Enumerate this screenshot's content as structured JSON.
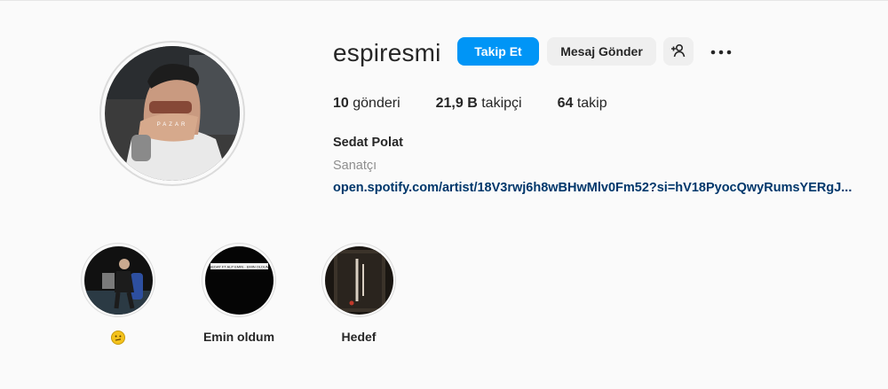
{
  "profile": {
    "username": "espiresmi",
    "full_name": "Sedat Polat",
    "category": "Sanatçı",
    "link": "open.spotify.com/artist/18V3rwj6h8wBHwMlv0Fm52?si=hV18PyocQwyRumsYERgJ...",
    "avatar_caption": "PAZAR"
  },
  "actions": {
    "follow_label": "Takip Et",
    "message_label": "Mesaj Gönder",
    "suggest_icon": "add-person-icon",
    "more_icon": "more-horizontal-icon"
  },
  "stats": {
    "posts_count": "10",
    "posts_label": "gönderi",
    "followers_count": "21,9 B",
    "followers_label": "takipçi",
    "following_count": "64",
    "following_label": "takip"
  },
  "highlights": [
    {
      "label": "🫤",
      "icon": "thinking-face-emoji"
    },
    {
      "label": "Emin oldum",
      "thumb_text": "SEDAT FT ALP EMIN · EMIN OLDUM"
    },
    {
      "label": "Hedef"
    }
  ],
  "colors": {
    "accent": "#0095f6",
    "link": "#00376b",
    "secondary_text": "#8e8e8e",
    "button_bg": "#efefef",
    "background": "#fafafa"
  }
}
